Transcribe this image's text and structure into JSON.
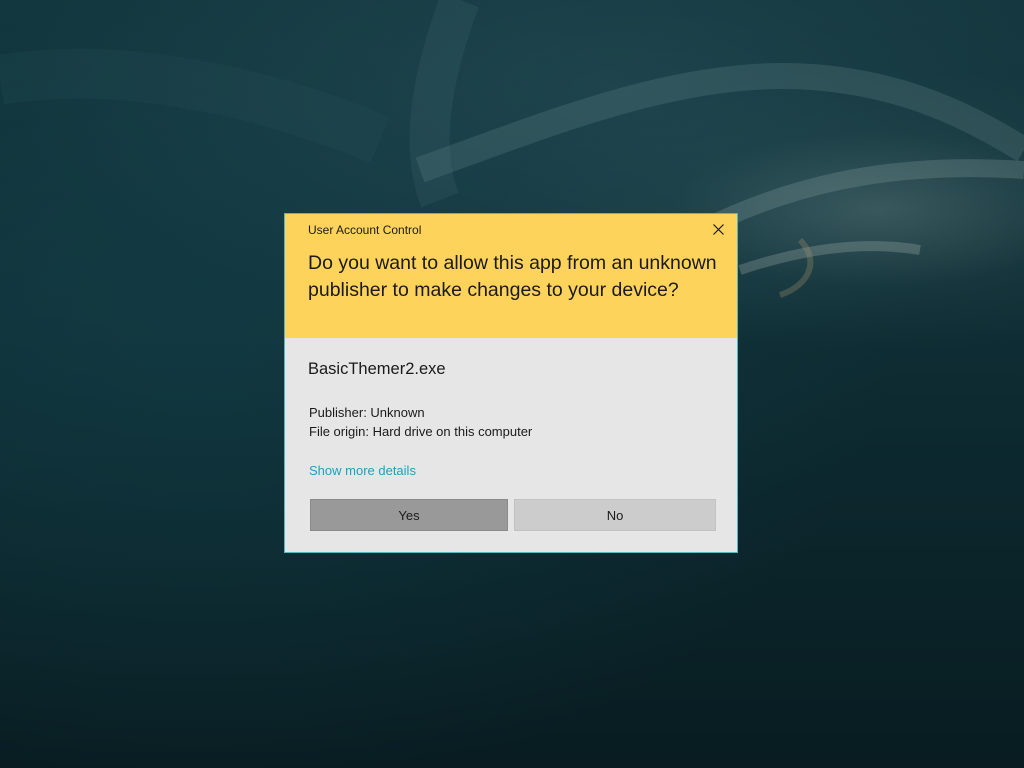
{
  "dialog": {
    "title": "User Account Control",
    "question": "Do you want to allow this app from an unknown publisher to make changes to your device?",
    "app_name": "BasicThemer2.exe",
    "publisher": "Publisher: Unknown",
    "file_origin": "File origin: Hard drive on this computer",
    "show_more_details": "Show more details",
    "yes_label": "Yes",
    "no_label": "No",
    "close_icon": "close-icon"
  },
  "colors": {
    "header_background": "#fdd35c",
    "body_background": "#e6e6e6",
    "border": "#55b6c4",
    "link": "#1e9fbd",
    "yes_button": "#999999",
    "no_button": "#cccccc",
    "desktop_background": "#12343b"
  }
}
